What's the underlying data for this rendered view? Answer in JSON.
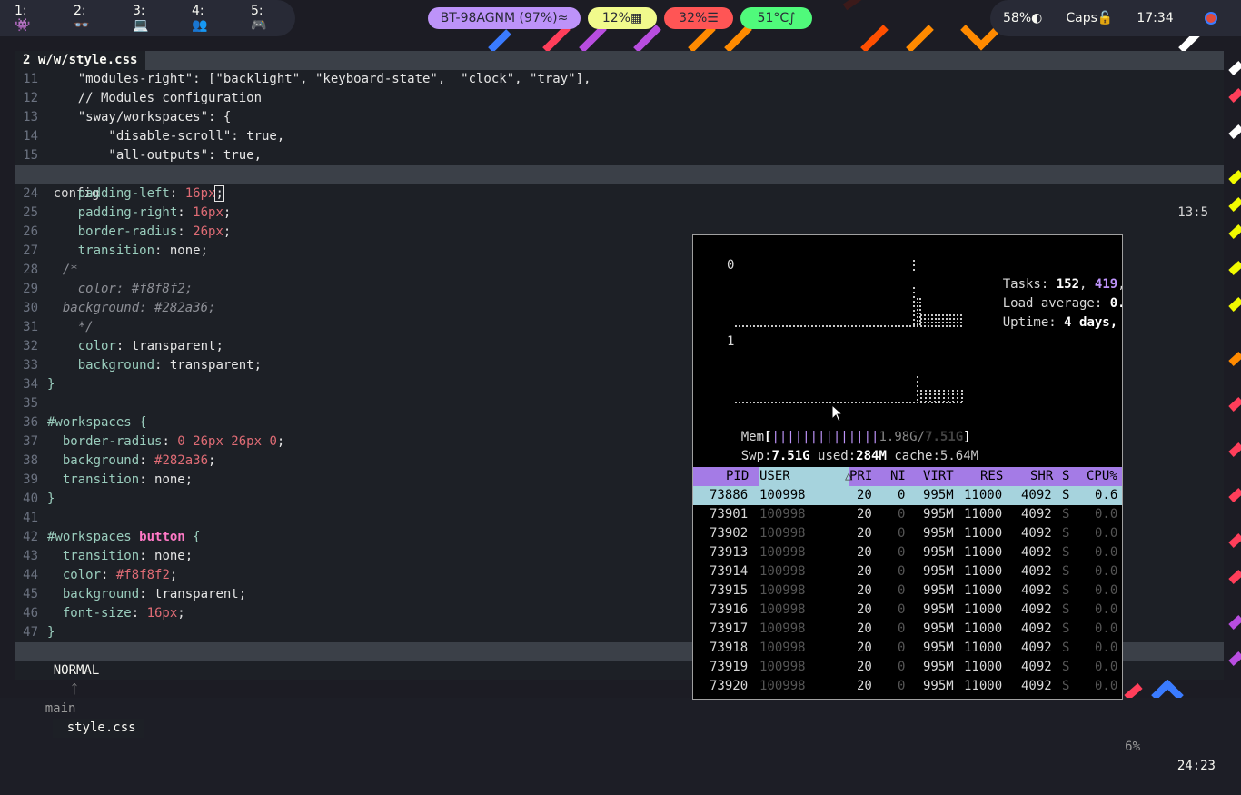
{
  "workspaces": [
    {
      "label": "1: 👾"
    },
    {
      "label": "2: 👓"
    },
    {
      "label": "3: 💻"
    },
    {
      "label": "4: 👥"
    },
    {
      "label": "5: 🎮"
    }
  ],
  "status": {
    "bluetooth": "BT-98AGNM (97%) ",
    "cpu": "12% ",
    "memory": "32% ",
    "temperature": "51°C ",
    "backlight": "58% ",
    "caps": "Caps ",
    "clock": "17:34"
  },
  "colors": {
    "bt": "#bd93f9",
    "cpu": "#f1fa8c",
    "mem": "#ff5555",
    "temp": "#50fa7b"
  },
  "editor": {
    "tab_number": "2",
    "tab_title": "w/w/style.css",
    "top_lines": [
      {
        "n": "11",
        "text": "    \"modules-right\": [\"backlight\", \"keyboard-state\",  \"clock\", \"tray\"],"
      },
      {
        "n": "12",
        "text": "    // Modules configuration"
      },
      {
        "n": "13",
        "text": "    \"sway/workspaces\": {"
      },
      {
        "n": "14",
        "text": "        \"disable-scroll\": true,"
      },
      {
        "n": "15",
        "text": "        \"all-outputs\": true,"
      }
    ],
    "split_name": "config",
    "split_pos": "13:5",
    "bottom_lines": [
      {
        "n": "24",
        "prop": "    padding-left",
        "val": "16px"
      },
      {
        "n": "25",
        "prop": "    padding-right",
        "val": "16px"
      },
      {
        "n": "26",
        "prop": "    border-radius",
        "val": "26px"
      },
      {
        "n": "27",
        "prop": "    transition",
        "val": "none"
      },
      {
        "n": "28",
        "comment": "  /*"
      },
      {
        "n": "29",
        "comment": "    color: #f8f8f2;"
      },
      {
        "n": "30",
        "comment": "  background: #282a36;"
      },
      {
        "n": "31",
        "comment": "    */"
      },
      {
        "n": "32",
        "prop": "    color",
        "val": "transparent"
      },
      {
        "n": "33",
        "prop": "    background",
        "val": "transparent"
      },
      {
        "n": "34",
        "brace": "}"
      },
      {
        "n": "35",
        "brace": ""
      },
      {
        "n": "36",
        "selector": "#workspaces",
        "brace": " {"
      },
      {
        "n": "37",
        "prop": "  border-radius",
        "val": "0 26px 26px 0"
      },
      {
        "n": "38",
        "prop": "  background",
        "val": "#282a36"
      },
      {
        "n": "39",
        "prop": "  transition",
        "val": "none"
      },
      {
        "n": "40",
        "brace": "}"
      },
      {
        "n": "41",
        "brace": ""
      },
      {
        "n": "42",
        "selector": "#workspaces",
        "selector2": "button",
        "brace": " {"
      },
      {
        "n": "43",
        "prop": "  transition",
        "val": "none"
      },
      {
        "n": "44",
        "prop": "  color",
        "val": "#f8f8f2"
      },
      {
        "n": "45",
        "prop": "  background",
        "val": "transparent"
      },
      {
        "n": "46",
        "prop": "  font-size",
        "val": "16px"
      },
      {
        "n": "47",
        "brace": "}"
      }
    ],
    "mode": "NORMAL",
    "branch": "main",
    "file": "style.css",
    "percent": "6%",
    "position": "24:23"
  },
  "htop": {
    "cpu0_label": "0",
    "cpu1_label": "1",
    "tasks_label": "Tasks: ",
    "tasks_a": "152",
    "tasks_b": "419",
    "load_label": "Load average: ",
    "load_val": "0.",
    "uptime_label": "Uptime: ",
    "uptime_val": "4 days,",
    "mem_label": "Mem",
    "mem_bar": "||||||||||||||",
    "mem_used": "1.98G",
    "mem_total": "7.51G",
    "swp_label": "Swp:",
    "swp_total": "7.51G",
    "swp_used_label": " used:",
    "swp_used": "284M",
    "swp_cache_label": " cache:",
    "swp_cache": "5.64M",
    "columns": [
      "PID",
      "USER",
      "PRI",
      "NI",
      "VIRT",
      "RES",
      "SHR",
      "S",
      "CPU%"
    ],
    "processes": [
      {
        "pid": "73886",
        "user": "100998",
        "pri": "20",
        "ni": "0",
        "virt": "995M",
        "res": "11000",
        "shr": "4092",
        "s": "S",
        "cpu": "0.6"
      },
      {
        "pid": "73901",
        "user": "100998",
        "pri": "20",
        "ni": "0",
        "virt": "995M",
        "res": "11000",
        "shr": "4092",
        "s": "S",
        "cpu": "0.0"
      },
      {
        "pid": "73902",
        "user": "100998",
        "pri": "20",
        "ni": "0",
        "virt": "995M",
        "res": "11000",
        "shr": "4092",
        "s": "S",
        "cpu": "0.0"
      },
      {
        "pid": "73913",
        "user": "100998",
        "pri": "20",
        "ni": "0",
        "virt": "995M",
        "res": "11000",
        "shr": "4092",
        "s": "S",
        "cpu": "0.0"
      },
      {
        "pid": "73914",
        "user": "100998",
        "pri": "20",
        "ni": "0",
        "virt": "995M",
        "res": "11000",
        "shr": "4092",
        "s": "S",
        "cpu": "0.0"
      },
      {
        "pid": "73915",
        "user": "100998",
        "pri": "20",
        "ni": "0",
        "virt": "995M",
        "res": "11000",
        "shr": "4092",
        "s": "S",
        "cpu": "0.0"
      },
      {
        "pid": "73916",
        "user": "100998",
        "pri": "20",
        "ni": "0",
        "virt": "995M",
        "res": "11000",
        "shr": "4092",
        "s": "S",
        "cpu": "0.0"
      },
      {
        "pid": "73917",
        "user": "100998",
        "pri": "20",
        "ni": "0",
        "virt": "995M",
        "res": "11000",
        "shr": "4092",
        "s": "S",
        "cpu": "0.0"
      },
      {
        "pid": "73918",
        "user": "100998",
        "pri": "20",
        "ni": "0",
        "virt": "995M",
        "res": "11000",
        "shr": "4092",
        "s": "S",
        "cpu": "0.0"
      },
      {
        "pid": "73919",
        "user": "100998",
        "pri": "20",
        "ni": "0",
        "virt": "995M",
        "res": "11000",
        "shr": "4092",
        "s": "S",
        "cpu": "0.0"
      },
      {
        "pid": "73920",
        "user": "100998",
        "pri": "20",
        "ni": "0",
        "virt": "995M",
        "res": "11000",
        "shr": "4092",
        "s": "S",
        "cpu": "0.0"
      }
    ]
  }
}
